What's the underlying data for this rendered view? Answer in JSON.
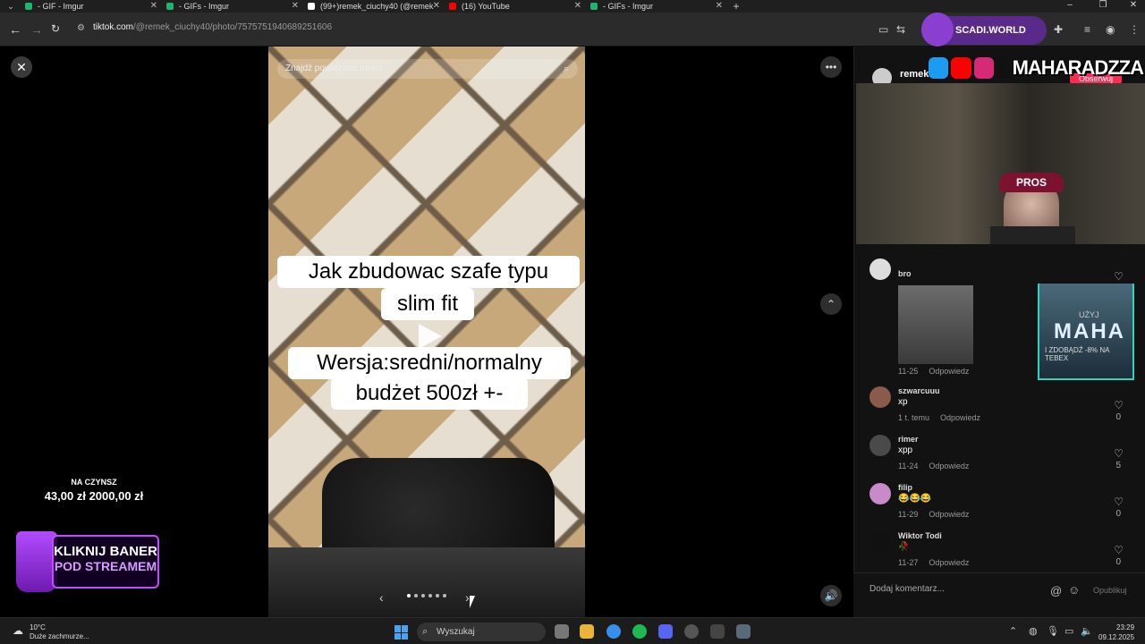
{
  "browser": {
    "tabs": [
      {
        "title": "- GIF - Imgur",
        "color": "#1bb76e"
      },
      {
        "title": "- GIFs - Imgur",
        "color": "#1bb76e"
      },
      {
        "title": "(99+)remek_ciuchy40 (@remek",
        "color": "#ffffff"
      },
      {
        "title": "(16) YouTube",
        "color": "#ff0000"
      },
      {
        "title": "- GIFs - Imgur",
        "color": "#1bb76e"
      }
    ],
    "url_host": "tiktok.com",
    "url_path": "/@remek_ciuchy40/photo/7575751940689251606"
  },
  "overlay": {
    "brand_chip": "SCADI.WORLD",
    "stream_name": "MAHARADZZA",
    "donation_label": "NA CZYNSZ",
    "donation_amount": "43,00 zł  2000,00 zł",
    "banner_line1": "KLIKNIJ BANER",
    "banner_line2": "POD STREAMEM",
    "cam_cap_text": "PROS"
  },
  "post": {
    "search_placeholder": "Znajdź powiązane treści",
    "caption1_line1": "Jak zbudowac szafe typu",
    "caption1_line2": "slim fit",
    "caption2_line1": "Wersja:sredni/normalny",
    "caption2_line2": "budżet 500zł +-",
    "slide_count": 6,
    "author_name": "remek",
    "follow_label": "Obserwuj"
  },
  "comments": [
    {
      "name": "bro",
      "text": "",
      "date": "11-25",
      "reply": "Odpowiedz",
      "likes": "",
      "avatar_color": "#dddddd",
      "has_image": true
    },
    {
      "name": "szwarcuuu",
      "text": "xp",
      "date": "1 t. temu",
      "reply": "Odpowiedz",
      "likes": "0",
      "avatar_color": "#8a5a4a"
    },
    {
      "name": "rimer",
      "text": "xpp",
      "date": "11-24",
      "reply": "Odpowiedz",
      "likes": "5",
      "avatar_color": "#4a4a4a"
    },
    {
      "name": "filip",
      "text": "😂😂😂",
      "date": "11-29",
      "reply": "Odpowiedz",
      "likes": "0",
      "avatar_color": "#c98ac9"
    },
    {
      "name": "Wiktor Todi",
      "text": "🥀",
      "date": "11-27",
      "reply": "Odpowiedz",
      "likes": "0",
      "avatar_color": "#111111"
    }
  ],
  "ad": {
    "top": "UŻYJ",
    "code": "MAHA",
    "bottom": "I ZDOBĄDŹ -8% NA TEBEX"
  },
  "comment_input": {
    "placeholder": "Dodaj komentarz...",
    "post_label": "Opublikuj"
  },
  "taskbar": {
    "temperature": "10°C",
    "weather_desc": "Duże zachmurze...",
    "search_label": "Wyszukaj",
    "time": "23:29",
    "date": "09.12.2025"
  }
}
